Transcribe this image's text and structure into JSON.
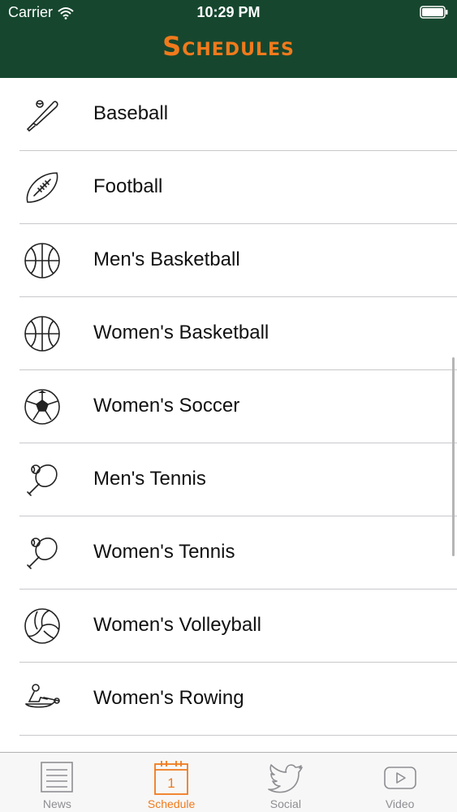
{
  "status_bar": {
    "carrier": "Carrier",
    "time": "10:29 PM"
  },
  "header": {
    "title": "Schedules"
  },
  "colors": {
    "header_bg": "#16472e",
    "accent": "#f07a1c",
    "tab_inactive": "#8e8e93"
  },
  "sports": [
    {
      "label": "Baseball",
      "icon": "baseball-bat-icon"
    },
    {
      "label": "Football",
      "icon": "football-icon"
    },
    {
      "label": "Men's Basketball",
      "icon": "basketball-icon"
    },
    {
      "label": "Women's Basketball",
      "icon": "basketball-icon"
    },
    {
      "label": "Women's Soccer",
      "icon": "soccer-ball-icon"
    },
    {
      "label": "Men's Tennis",
      "icon": "tennis-racket-icon"
    },
    {
      "label": "Women's Tennis",
      "icon": "tennis-racket-icon"
    },
    {
      "label": "Women's Volleyball",
      "icon": "volleyball-icon"
    },
    {
      "label": "Women's Rowing",
      "icon": "rowing-icon"
    }
  ],
  "tabs": [
    {
      "label": "News",
      "icon": "news-icon",
      "active": false
    },
    {
      "label": "Schedule",
      "icon": "calendar-icon",
      "active": true,
      "badge": "1"
    },
    {
      "label": "Social",
      "icon": "twitter-bird-icon",
      "active": false
    },
    {
      "label": "Video",
      "icon": "play-video-icon",
      "active": false
    }
  ]
}
